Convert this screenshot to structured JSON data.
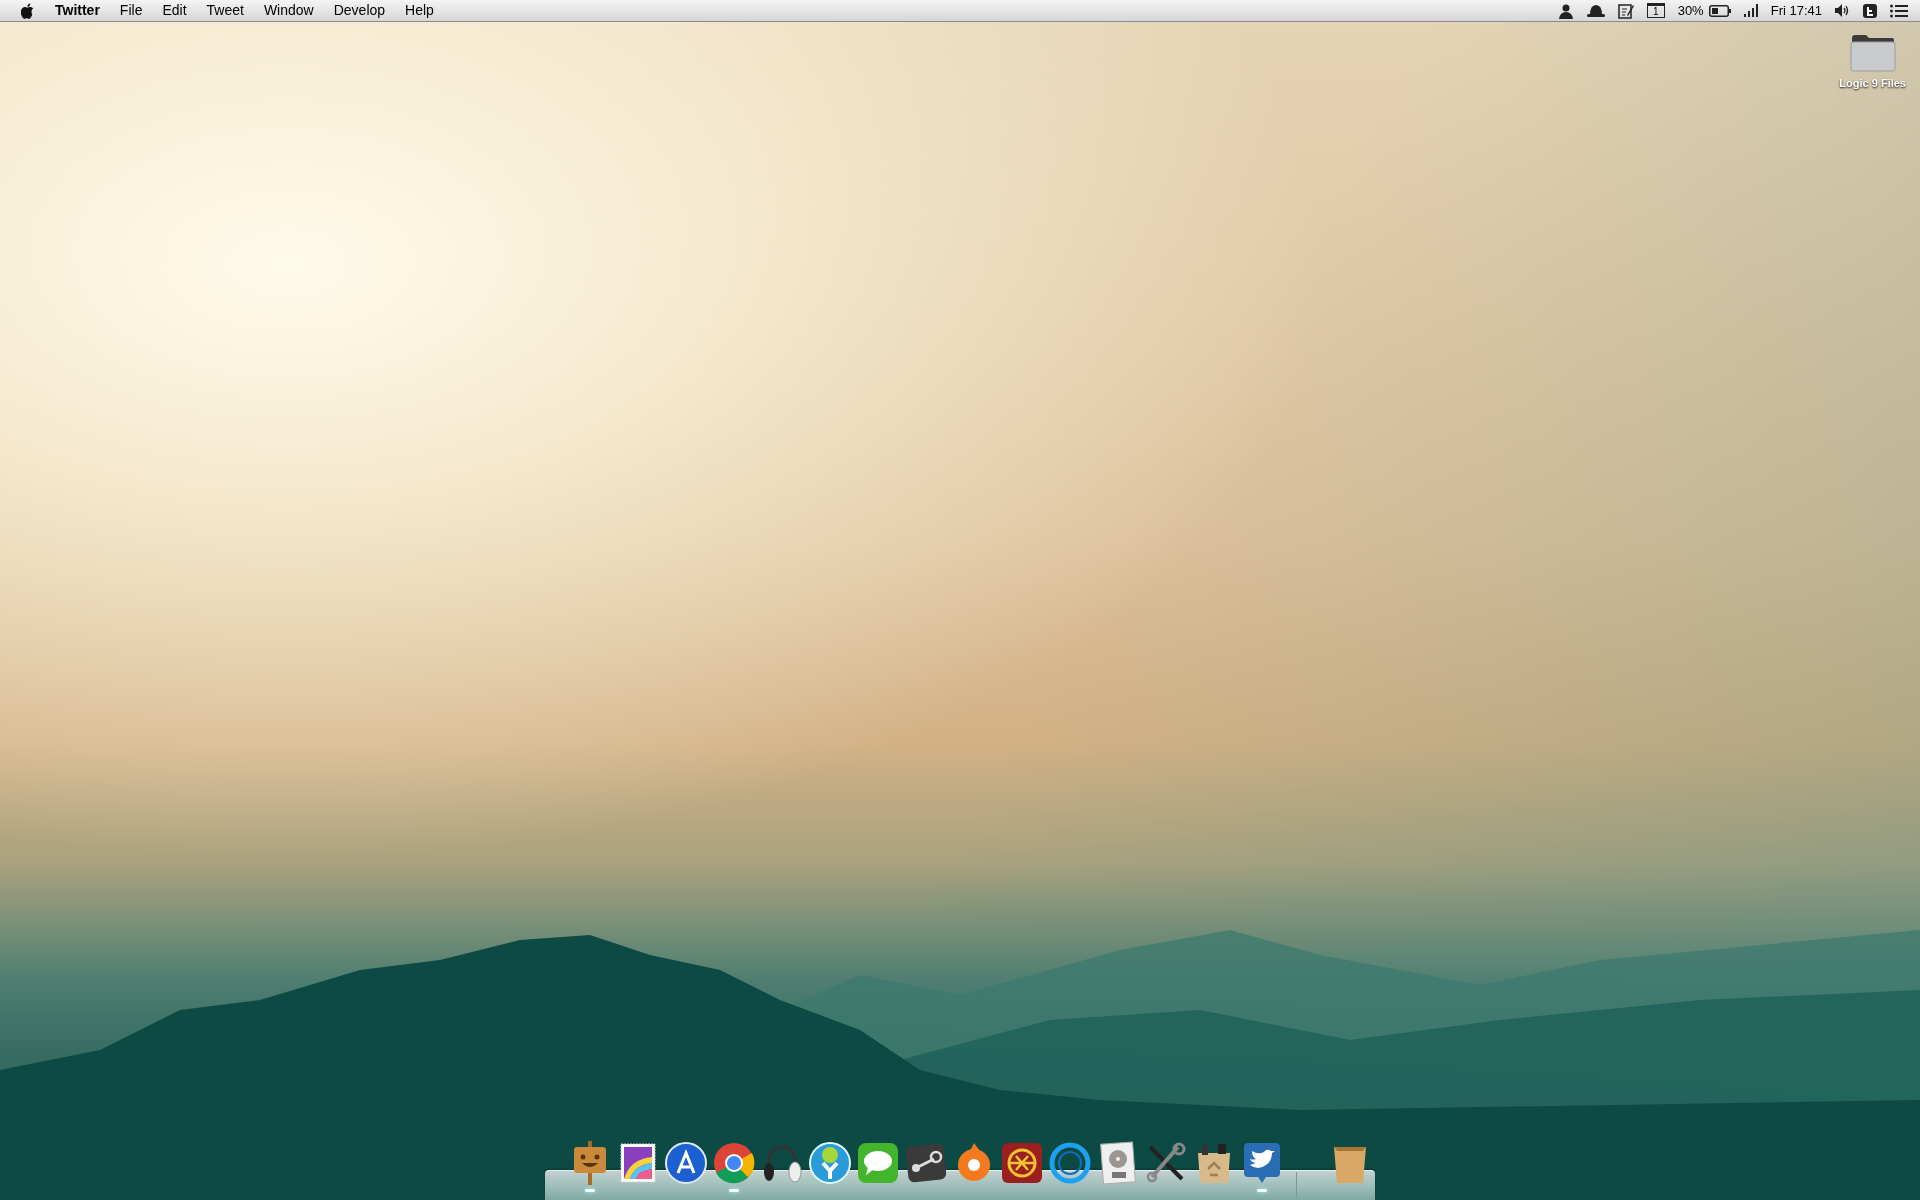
{
  "menu_bar": {
    "app_name": "Twitter",
    "menus": [
      "File",
      "Edit",
      "Tweet",
      "Window",
      "Develop",
      "Help"
    ],
    "status": {
      "calendar_day": "1",
      "battery_percent": "30%",
      "clock": "Fri 17:41"
    }
  },
  "desktop_icons": [
    {
      "label": "Logic 9 Files"
    }
  ],
  "dock": {
    "items": [
      {
        "running": true
      },
      {
        "running": false
      },
      {
        "running": false
      },
      {
        "running": true
      },
      {
        "running": false
      },
      {
        "running": false
      },
      {
        "running": false
      },
      {
        "running": false
      },
      {
        "running": false
      },
      {
        "running": false
      },
      {
        "running": false
      },
      {
        "running": false
      },
      {
        "running": false
      },
      {
        "running": false
      },
      {
        "running": true
      }
    ]
  }
}
